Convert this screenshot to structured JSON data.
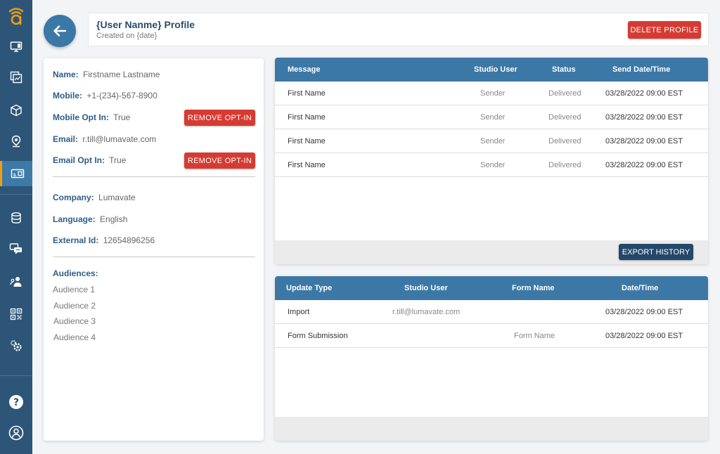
{
  "header": {
    "title": "{User Nanme} Profile",
    "subtitle": "Created on {date}",
    "delete_label": "DELETE PROFILE"
  },
  "sidebar": {
    "items": [
      {
        "icon": "monitor-icon"
      },
      {
        "icon": "analytics-icon"
      },
      {
        "icon": "cube-icon"
      },
      {
        "icon": "location-pin-icon"
      },
      {
        "icon": "id-card-icon",
        "active": true
      },
      {
        "icon": "database-icon"
      },
      {
        "icon": "chat-icon"
      },
      {
        "icon": "users-icon"
      },
      {
        "icon": "qr-code-icon"
      },
      {
        "icon": "settings-icon"
      },
      {
        "icon": "help-icon"
      },
      {
        "icon": "user-account-icon"
      }
    ]
  },
  "profile": {
    "name_label": "Name:",
    "name": "Firstname Lastname",
    "mobile_label": "Mobile:",
    "mobile": "+1-(234)-567-8900",
    "mobile_opt_label": "Mobile Opt In:",
    "mobile_opt": "True",
    "email_label": "Email:",
    "email": "r.till@lumavate.com",
    "email_opt_label": "Email Opt In:",
    "email_opt": "True",
    "remove_opt_label": "REMOVE OPT-IN",
    "company_label": "Company:",
    "company": "Lumavate",
    "language_label": "Language:",
    "language": "English",
    "external_label": "External Id:",
    "external_id": "12654896256",
    "audiences_label": "Audiences:",
    "audiences": [
      "Audience 1",
      "Audience 2",
      "Audience 3",
      "Audience 4"
    ]
  },
  "messages": {
    "headers": [
      "Message",
      "Studio User",
      "Status",
      "Send Date/Time"
    ],
    "rows": [
      [
        "First Name",
        "Sender",
        "Delivered",
        "03/28/2022 09:00 EST"
      ],
      [
        "First Name",
        "Sender",
        "Delivered",
        "03/28/2022 09:00 EST"
      ],
      [
        "First Name",
        "Sender",
        "Delivered",
        "03/28/2022 09:00 EST"
      ],
      [
        "First Name",
        "Sender",
        "Delivered",
        "03/28/2022 09:00 EST"
      ]
    ],
    "export_label": "EXPORT HISTORY"
  },
  "updates": {
    "headers": [
      "Update Type",
      "Studio User",
      "Form Name",
      "Date/Time"
    ],
    "rows": [
      [
        "Import",
        "r.till@lumavate.com",
        "",
        "03/28/2022 09:00 EST"
      ],
      [
        "Form Submission",
        "",
        "Form Name",
        "03/28/2022 09:00 EST"
      ]
    ]
  },
  "colors": {
    "sidebar": "#2c5578",
    "accent_blue": "#3c78a6",
    "danger": "#d53b33",
    "dark_button": "#24486a",
    "active_marker": "#f39c12"
  }
}
